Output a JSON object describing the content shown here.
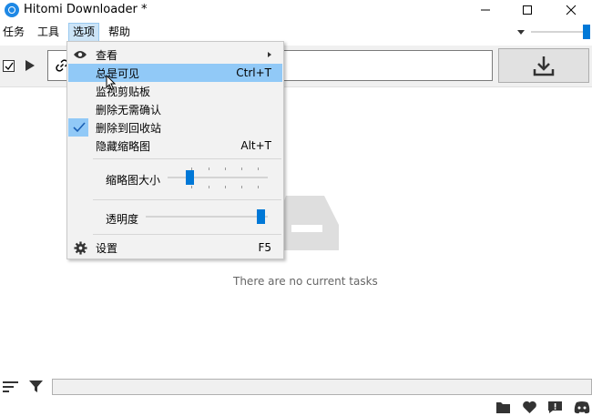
{
  "window": {
    "title": "Hitomi Downloader *"
  },
  "menubar": {
    "items": [
      "任务",
      "工具",
      "选项",
      "帮助"
    ],
    "active_index": 2
  },
  "toolbar": {
    "url_value": "",
    "download_icon": "download-icon"
  },
  "top_slider": {
    "value": 1.0
  },
  "options_menu": {
    "view_label": "查看",
    "always_visible_label": "总是可见",
    "always_visible_shortcut": "Ctrl+T",
    "monitor_clipboard_label": "监视剪贴板",
    "delete_no_confirm_label": "删除无需确认",
    "delete_to_recycle_label": "删除到回收站",
    "hide_thumbnails_label": "隐藏缩略图",
    "hide_thumbnails_shortcut": "Alt+T",
    "thumbnail_size_label": "缩略图大小",
    "thumbnail_size_value": 0.2,
    "opacity_label": "透明度",
    "opacity_value": 1.0,
    "settings_label": "设置",
    "settings_shortcut": "F5"
  },
  "main": {
    "empty_text": "There are no current tasks"
  },
  "colors": {
    "accent": "#0078d7",
    "highlight": "#91c9f7",
    "menu_bg": "#f2f2f2"
  }
}
